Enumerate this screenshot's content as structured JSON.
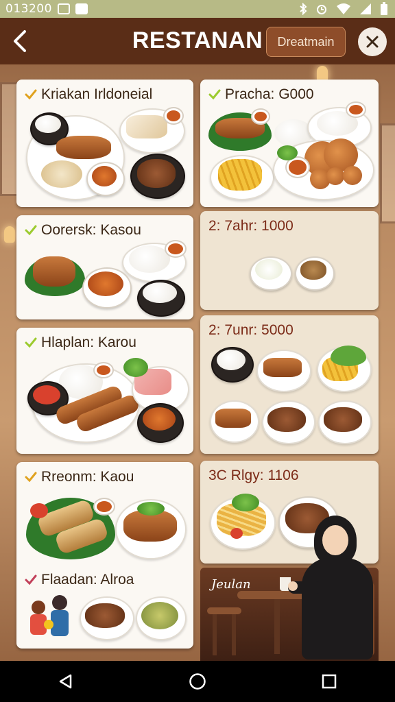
{
  "status_bar": {
    "time": "013200"
  },
  "header": {
    "title": "RESTANAN",
    "pill_label": "Dreatmain"
  },
  "cards": [
    {
      "title": "Kriakan Irldoneial",
      "check_color": "#e0a21f"
    },
    {
      "title": "Pracha: G000",
      "check_color": "#9ccb2f"
    },
    {
      "title": "Oorersk: Kasou",
      "check_color": "#9ccb2f"
    },
    {
      "title": "2: 7ahr: 1000",
      "check_color": ""
    },
    {
      "title": "Hlaplan: Karou",
      "check_color": "#9ccb2f"
    },
    {
      "title": "2: 7unr: 5000",
      "check_color": ""
    },
    {
      "title": "Rreonm: Kaou",
      "check_color": "#e0a21f"
    },
    {
      "title": "3C Rlgy: 1106",
      "check_color": ""
    },
    {
      "title": "Flaadan: Alroa",
      "check_color": "#c2405a"
    }
  ],
  "sign_label": "Jeulan",
  "colors": {
    "header_bg": "#5a2d17",
    "status_bar_bg": "#b7ba86",
    "card_bg": "#fbf8f3",
    "card_alt_bg": "#efe4d2",
    "title_text": "#3b2716",
    "price_text": "#7c2b18"
  },
  "icons": {
    "back": "chevron-left-icon",
    "close": "close-icon",
    "check": "check-icon",
    "nav_back": "triangle-back-icon",
    "nav_home": "circle-home-icon",
    "nav_recent": "square-recent-icon"
  }
}
